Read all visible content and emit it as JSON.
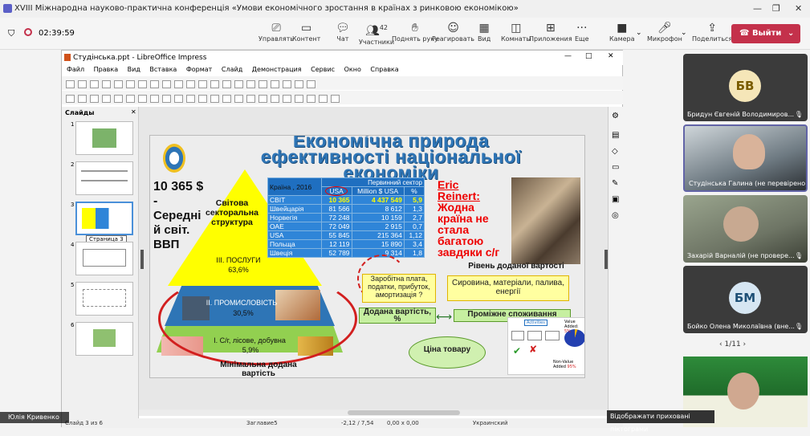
{
  "window": {
    "title": "XVIII Міжнародна науково-практична конференція «Умови економічного зростання в країнах з ринковою економікою»"
  },
  "meeting": {
    "timer": "02:39:59",
    "buttons": [
      {
        "label": "Управлять",
        "icon": "share-control-icon"
      },
      {
        "label": "Контент",
        "icon": "content-icon"
      },
      {
        "label": "Чат",
        "icon": "chat-icon"
      },
      {
        "label": "Участники",
        "icon": "people-icon",
        "count": "42"
      },
      {
        "label": "Поднять руку",
        "icon": "raise-hand-icon"
      },
      {
        "label": "Реагировать",
        "icon": "react-icon"
      },
      {
        "label": "Вид",
        "icon": "view-icon"
      },
      {
        "label": "Комнаты",
        "icon": "rooms-icon"
      },
      {
        "label": "Приложения",
        "icon": "apps-icon"
      },
      {
        "label": "Еще",
        "icon": "more-icon"
      },
      {
        "label": "Камера",
        "icon": "camera-icon"
      },
      {
        "label": "Микрофон",
        "icon": "mic-icon"
      },
      {
        "label": "Поделиться",
        "icon": "share-icon"
      }
    ],
    "leave_label": "Выйти"
  },
  "impress": {
    "title": "Студінська.ppt - LibreOffice Impress",
    "menu": [
      "Файл",
      "Правка",
      "Вид",
      "Вставка",
      "Формат",
      "Слайд",
      "Демонстрация",
      "Сервис",
      "Окно",
      "Справка"
    ],
    "slides_panel_title": "Слайды",
    "slide_numbers": [
      "1",
      "2",
      "3",
      "4",
      "5",
      "6"
    ],
    "tooltip_text": "Страница 3",
    "status": {
      "slide": "Слайд 3 из 6",
      "layout": "Заглавие5",
      "position": "-2,12 / 7,54",
      "size": "0,00 x 0,00",
      "language": "Украинский"
    }
  },
  "slide": {
    "title_line1": "Економічна природа",
    "title_line2": "ефективності національної",
    "title_line3": "економіки",
    "gdp_value": "10 365 $",
    "gdp_dash": "-",
    "gdp_text": "Середні й світ. ВВП",
    "pyramid_top_label": "Світова секторальна структура",
    "services_label": "ІІІ. ПОСЛУГИ",
    "services_pct": "63,6%",
    "industry_label": "ІІ. ПРОМИСЛОВІСТЬ",
    "industry_pct": "30,5%",
    "agri_label": "І. С/г, лісове, добувна",
    "agri_pct": "5,9%",
    "min_value_label": "Мінімальна додана вартість",
    "table": {
      "header_country": "Країна , 2016",
      "header_sector": "Первинний сектор",
      "header_usa": "USA",
      "header_million": "Million $ USA",
      "header_pct": "%",
      "rows": [
        {
          "country": "СВІТ",
          "usd": "10 365",
          "million": "4 437 549",
          "pct": "5,9"
        },
        {
          "country": "Швейцарія",
          "usd": "81 566",
          "million": "8 612",
          "pct": "1,3"
        },
        {
          "country": "Норвегія",
          "usd": "72 248",
          "million": "10 159",
          "pct": "2,7"
        },
        {
          "country": "ОАЕ",
          "usd": "72 049",
          "million": "2 915",
          "pct": "0,7"
        },
        {
          "country": "USA",
          "usd": "55 845",
          "million": "215 364",
          "pct": "1,12"
        },
        {
          "country": "Польща",
          "usd": "12 119",
          "million": "15 890",
          "pct": "3,4"
        },
        {
          "country": "Швеція",
          "usd": "52 789",
          "million": "9 314",
          "pct": "1,8"
        }
      ]
    },
    "eric_line1": "Eric",
    "eric_line2": "Reinert:",
    "eric_quote": "Жодна країна не стала багатою завдяки с/г",
    "value_added_title": "Рівень доданої вартості",
    "box_wages": "Заробітна плата, податки, прибуток, амортизація ?",
    "box_materials": "Сировина, матеріали, палива, енергії",
    "box_value_added_pct": "Додана вартість, %",
    "box_intermediate": "Проміжне споживання",
    "box_price": "Ціна товару",
    "va_diagram": {
      "activities": "Activities",
      "value_added_label": "Value Added",
      "value_added_pct": "5%",
      "non_value_added_label": "Non-Value Added",
      "non_value_added_pct": "95%"
    }
  },
  "participants": [
    {
      "name": "Бридун Євгеній Володимиров...",
      "initials": "БВ",
      "color": "#f5e6b8",
      "text_color": "#7a5c00"
    },
    {
      "name": "Студінська Галина (не перевірено)",
      "initials": "",
      "color": "#9aa3a8"
    },
    {
      "name": "Захарій Варналій (не провере...",
      "initials": "",
      "color": "#7f8a74"
    },
    {
      "name": "Бойко Олена Миколаївна (вне...",
      "initials": "БМ",
      "color": "#d6e6f2",
      "text_color": "#1d4f75"
    }
  ],
  "pager": "1/11",
  "presenter_name": "Юлія Кривенко",
  "hidden_tooltip": "Відображати приховані піктограми"
}
